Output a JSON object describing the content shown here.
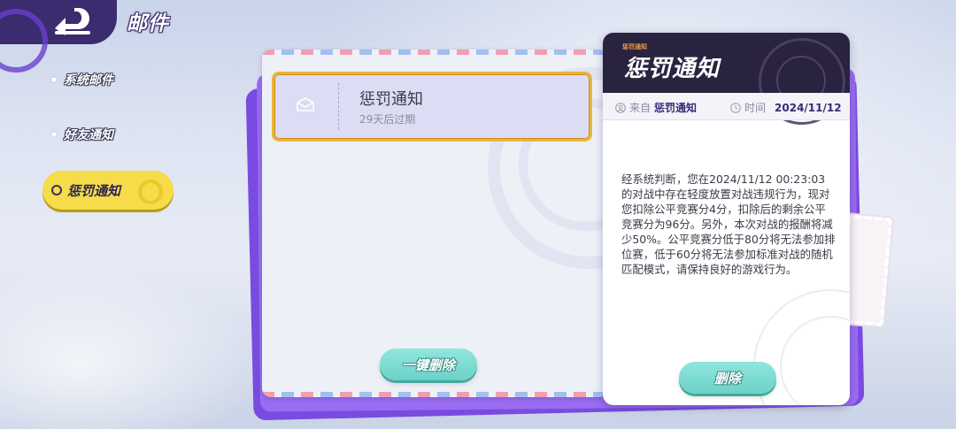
{
  "header": {
    "title": "邮件"
  },
  "sidebar": {
    "items": [
      {
        "label": "系统邮件"
      },
      {
        "label": "好友通知"
      },
      {
        "label": "惩罚通知",
        "active": true
      }
    ]
  },
  "mail_list": {
    "items": [
      {
        "subject": "惩罚通知",
        "expire": "29天后过期",
        "selected": true
      }
    ],
    "delete_all_label": "一键删除"
  },
  "detail": {
    "small_label": "惩罚通知",
    "title": "惩罚通知",
    "from_key": "来自",
    "from_value": "惩罚通知",
    "time_key": "时间",
    "time_value": "2024/11/12",
    "body": "经系统判断，您在2024/11/12 00:23:03的对战中存在轻度放置对战违规行为，现对您扣除公平竞赛分4分，扣除后的剩余公平竞赛分为96分。另外，本次对战的报酬将减少50%。公平竞赛分低于80分将无法参加排位赛，低于60分将无法参加标准对战的随机匹配模式，请保持良好的游戏行为。",
    "delete_label": "删除"
  },
  "icons": {
    "back": "back-arrow-icon",
    "envelope": "envelope-icon",
    "user": "user-icon",
    "clock": "clock-icon"
  },
  "colors": {
    "accent_yellow": "#f6dc48",
    "panel_purple": "#7a4be0",
    "header_dark": "#2a2340",
    "button_teal": "#6cd2c8",
    "selected_border": "#e8b63a"
  }
}
